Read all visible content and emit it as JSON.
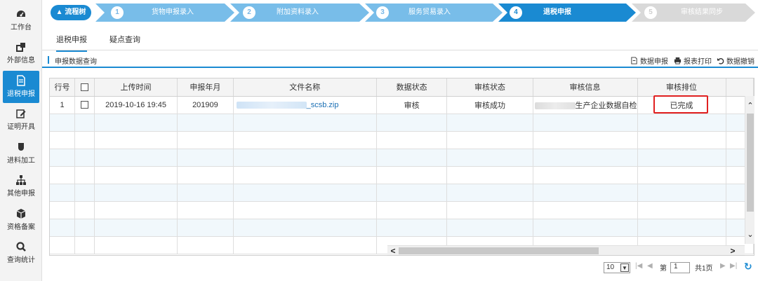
{
  "sidebar": {
    "items": [
      {
        "label": "工作台",
        "icon": "dashboard-icon"
      },
      {
        "label": "外部信息",
        "icon": "external-link-icon"
      },
      {
        "label": "退税申报",
        "icon": "document-icon"
      },
      {
        "label": "证明开具",
        "icon": "edit-icon"
      },
      {
        "label": "进料加工",
        "icon": "shield-icon"
      },
      {
        "label": "其他申报",
        "icon": "org-chart-icon"
      },
      {
        "label": "资格备案",
        "icon": "box-icon"
      },
      {
        "label": "查询统计",
        "icon": "search-icon"
      }
    ],
    "active_index": 2
  },
  "steps": {
    "root_label": "流程树",
    "items": [
      {
        "num": "1",
        "label": "货物申报录入"
      },
      {
        "num": "2",
        "label": "附加资料录入"
      },
      {
        "num": "3",
        "label": "服务贸易录入"
      },
      {
        "num": "4",
        "label": "退税申报"
      },
      {
        "num": "5",
        "label": "审核结果同步"
      }
    ],
    "active_index": 3
  },
  "tabs": [
    "退税申报",
    "疑点查询"
  ],
  "query_bar": {
    "title": "申报数据查询",
    "actions": [
      "数据申报",
      "报表打印",
      "数据撤销"
    ]
  },
  "table": {
    "headers": [
      "行号",
      "",
      "上传时间",
      "申报年月",
      "文件名称",
      "数据状态",
      "审核状态",
      "审核信息",
      "审核排位"
    ],
    "rows": [
      {
        "row_no": "1",
        "upload_time": "2019-10-16 19:45",
        "period": "201909",
        "file_name": "_scsb.zip",
        "data_status": "审核",
        "review_status": "审核成功",
        "review_info": "生产企业数据自检",
        "rank": "已完成"
      }
    ]
  },
  "pager": {
    "page_size": "10",
    "page_label": "第",
    "page_value": "1",
    "total_pages": "共1页"
  },
  "colors": {
    "accent": "#1a8ad2",
    "highlight_border": "#e02020"
  }
}
